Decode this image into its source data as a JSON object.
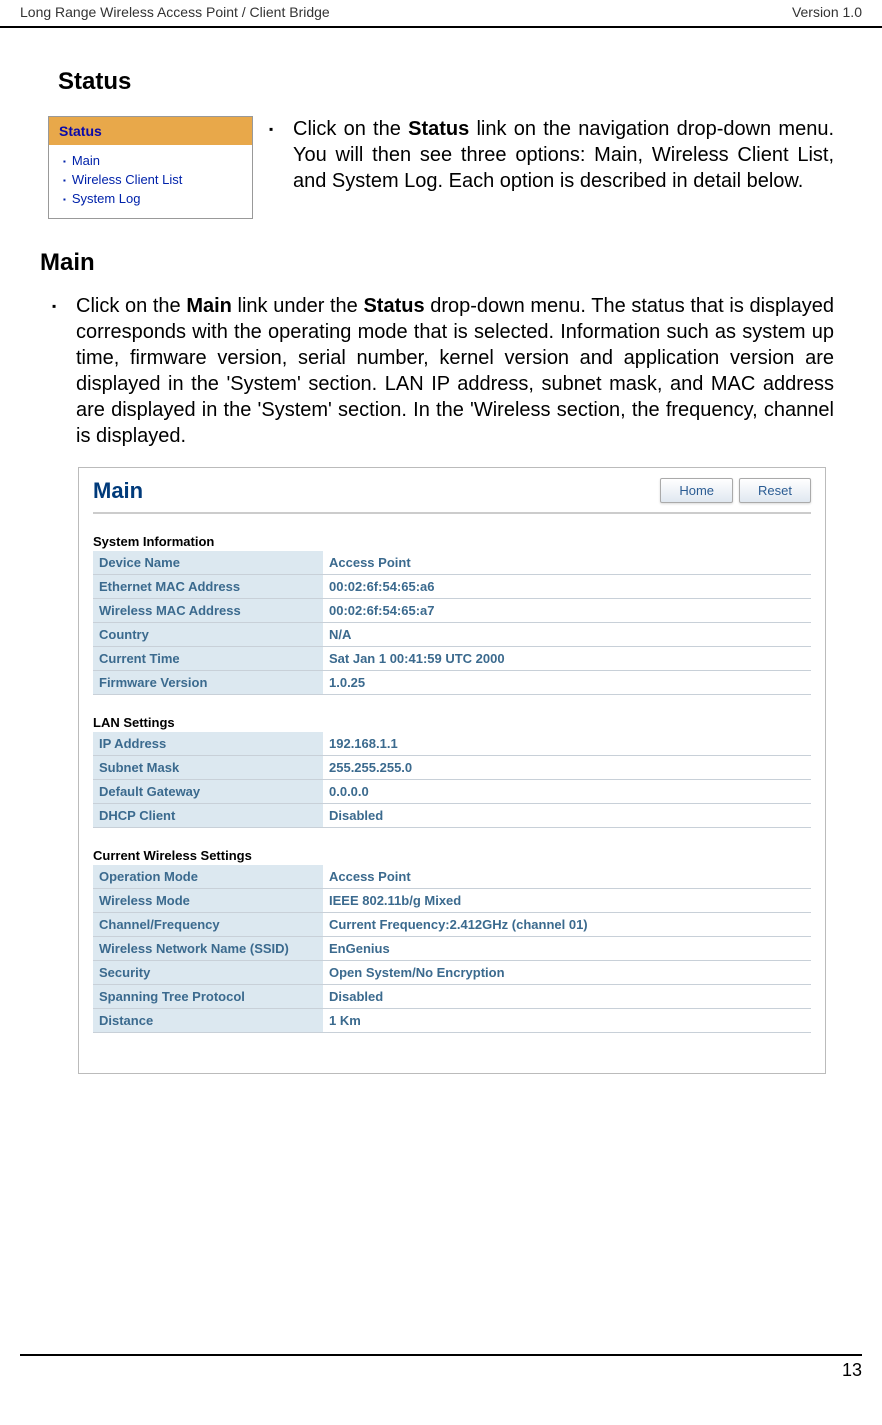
{
  "header": {
    "left": "Long Range Wireless Access Point / Client Bridge",
    "right": "Version 1.0"
  },
  "page_number": "13",
  "status": {
    "heading": "Status",
    "menu": {
      "title": "Status",
      "items": [
        "Main",
        "Wireless Client List",
        "System Log"
      ]
    },
    "bullet_prefix": "Click on the ",
    "bullet_bold": "Status",
    "bullet_suffix": " link on the navigation drop-down menu. You will then see three options: Main, Wireless Client List, and System Log. Each option is described in detail below."
  },
  "main": {
    "heading": "Main",
    "bullet_p1": "Click on the ",
    "bullet_b1": "Main",
    "bullet_p2": " link under the ",
    "bullet_b2": "Status",
    "bullet_p3": " drop-down menu. The status that is displayed corresponds with the operating mode that is selected. Information such as system up time, firmware version, serial number, kernel version and application version are displayed in the 'System' section. LAN IP address, subnet mask, and MAC address are displayed in the 'System' section. In the 'Wireless section, the frequency, channel is displayed.",
    "panel_title": "Main",
    "buttons": {
      "home": "Home",
      "reset": "Reset"
    },
    "section1_label": "System Information",
    "section1": [
      {
        "k": "Device Name",
        "v": "Access Point"
      },
      {
        "k": "Ethernet MAC Address",
        "v": "00:02:6f:54:65:a6"
      },
      {
        "k": "Wireless MAC Address",
        "v": "00:02:6f:54:65:a7"
      },
      {
        "k": "Country",
        "v": "N/A"
      },
      {
        "k": "Current Time",
        "v": "Sat Jan 1 00:41:59 UTC 2000"
      },
      {
        "k": "Firmware Version",
        "v": "1.0.25"
      }
    ],
    "section2_label": "LAN Settings",
    "section2": [
      {
        "k": "IP Address",
        "v": "192.168.1.1"
      },
      {
        "k": "Subnet Mask",
        "v": "255.255.255.0"
      },
      {
        "k": "Default Gateway",
        "v": "0.0.0.0"
      },
      {
        "k": "DHCP Client",
        "v": "Disabled"
      }
    ],
    "section3_label": "Current Wireless Settings",
    "section3": [
      {
        "k": "Operation Mode",
        "v": "Access Point"
      },
      {
        "k": "Wireless Mode",
        "v": "IEEE 802.11b/g Mixed"
      },
      {
        "k": "Channel/Frequency",
        "v": "Current Frequency:2.412GHz (channel 01)"
      },
      {
        "k": "Wireless Network Name (SSID)",
        "v": "EnGenius"
      },
      {
        "k": "Security",
        "v": "Open System/No Encryption"
      },
      {
        "k": "Spanning Tree Protocol",
        "v": "Disabled"
      },
      {
        "k": "Distance",
        "v": "1 Km"
      }
    ]
  }
}
